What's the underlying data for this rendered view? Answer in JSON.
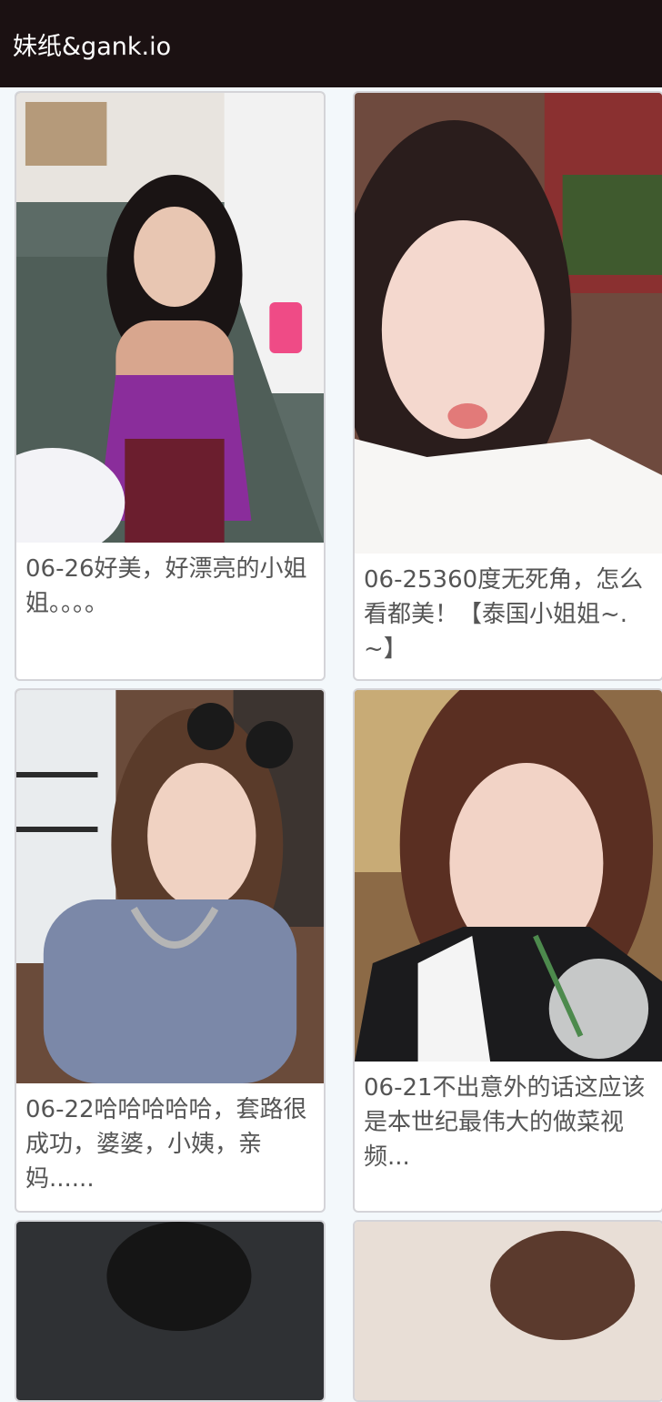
{
  "app": {
    "title": "妹纸&gank.io"
  },
  "cards": [
    {
      "caption": "06-26好美，好漂亮的小姐姐。。。。",
      "photo_alt": "cosplay-selfie-photo"
    },
    {
      "caption": "06-25360度无死角，怎么看都美！【泰国小姐姐~.~】",
      "photo_alt": "selfie-white-sweater-photo"
    },
    {
      "caption": "06-22哈哈哈哈哈，套路很成功，婆婆，小姨，亲妈......",
      "photo_alt": "selfie-sunglasses-photo"
    },
    {
      "caption": "06-21不出意外的话这应该是本世纪最伟大的做菜视频...",
      "photo_alt": "selfie-drink-photo"
    },
    {
      "caption": "",
      "photo_alt": "photo-partial"
    },
    {
      "caption": "",
      "photo_alt": "photo-partial"
    }
  ]
}
